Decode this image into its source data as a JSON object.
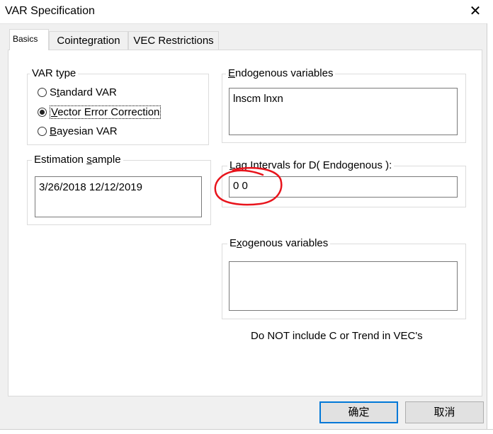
{
  "window": {
    "title": "VAR Specification",
    "close_glyph": "✕"
  },
  "tabs": [
    {
      "label": "Basics",
      "active": true
    },
    {
      "label": "Cointegration",
      "active": false
    },
    {
      "label": "VEC Restrictions",
      "active": false
    }
  ],
  "var_type": {
    "legend": "VAR type",
    "options": [
      {
        "label": "Standard VAR",
        "checked": false
      },
      {
        "label": "Vector Error Correction",
        "checked": true
      },
      {
        "label": "Bayesian VAR",
        "checked": false
      }
    ]
  },
  "endogenous": {
    "legend": "Endogenous variables",
    "value": "lnscm lnxn"
  },
  "estimation_sample": {
    "legend": "Estimation sample",
    "value": "3/26/2018 12/12/2019"
  },
  "lag_intervals": {
    "legend": "Lag Intervals for D( Endogenous ):",
    "value": "0 0"
  },
  "exogenous": {
    "legend": "Exogenous variables",
    "value": ""
  },
  "note": "Do NOT include C or Trend in VEC's",
  "buttons": {
    "ok": "确定",
    "cancel": "取消"
  },
  "colors": {
    "annotation": "#e8141c",
    "default_button_border": "#0078d7"
  }
}
